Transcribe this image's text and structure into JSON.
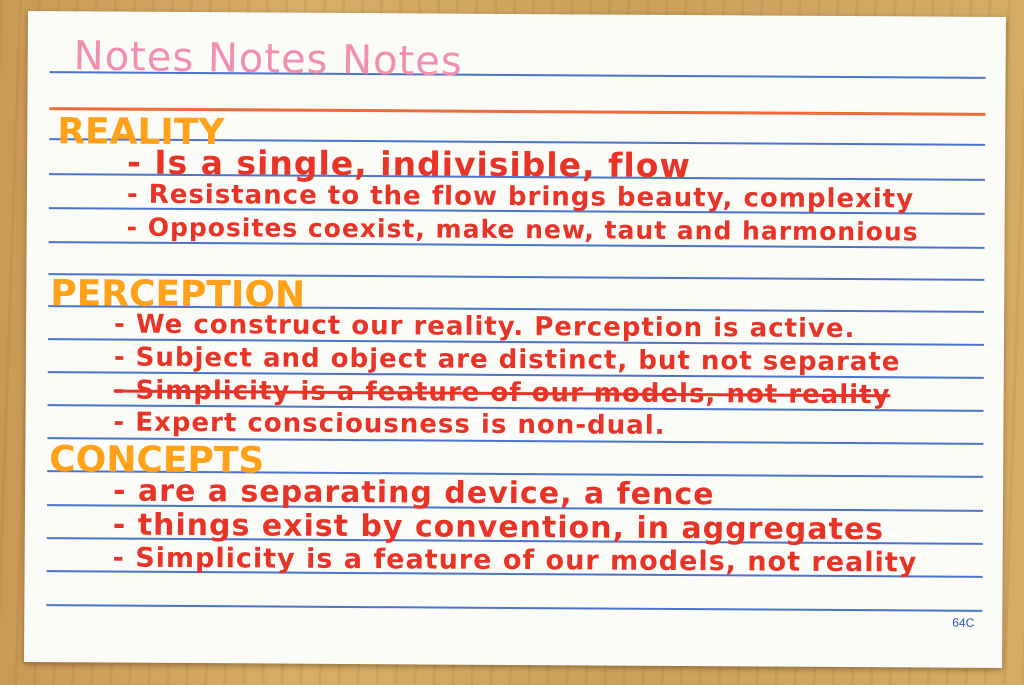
{
  "card": {
    "title": "Notes Notes Notes",
    "number": "64C"
  },
  "sections": [
    {
      "heading": "REALITY",
      "items": [
        "- Is a single, indivisible, flow",
        "- Resistance to the flow brings beauty, complexity",
        "- Opposites coexist, make new, taut and harmonious"
      ]
    },
    {
      "heading": "PERCEPTION",
      "items": [
        "- We construct our reality. Perception is active.",
        "- Subject and object are distinct, but not separate",
        "- Simplicity is a feature of our models, not reality",
        "- Expert consciousness is non-dual."
      ]
    },
    {
      "heading": "CONCEPTS",
      "items": [
        "- are a separating device, a fence",
        "- things exist by convention, in aggregates",
        "- Simplicity is a feature of our models, not reality"
      ]
    }
  ]
}
